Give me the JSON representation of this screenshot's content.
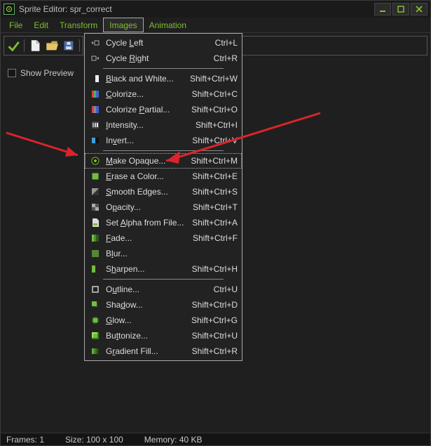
{
  "title": "Sprite Editor: spr_correct",
  "menubar": [
    "File",
    "Edit",
    "Transform",
    "Images",
    "Animation"
  ],
  "menubar_active_index": 3,
  "show_preview_label": "Show Preview",
  "status": {
    "frames_label": "Frames:",
    "frames_value": "1",
    "size_label": "Size:",
    "size_value": "100 x 100",
    "memory_label": "Memory:",
    "memory_value": "40 KB"
  },
  "dropdown": {
    "highlight_index": 7,
    "items": [
      {
        "label": "Cycle Left",
        "u": 6,
        "short": "Ctrl+L",
        "icon": "cycle-left-icon"
      },
      {
        "label": "Cycle Right",
        "u": 6,
        "short": "Ctrl+R",
        "icon": "cycle-right-icon"
      },
      {
        "sep": true
      },
      {
        "label": "Black and White...",
        "u": 0,
        "short": "Shift+Ctrl+W",
        "icon": "bw-icon"
      },
      {
        "label": "Colorize...",
        "u": 0,
        "short": "Shift+Ctrl+C",
        "icon": "colorize-icon"
      },
      {
        "label": "Colorize Partial...",
        "u": 9,
        "short": "Shift+Ctrl+O",
        "icon": "colorize-partial-icon"
      },
      {
        "label": "Intensity...",
        "u": 0,
        "short": "Shift+Ctrl+I",
        "icon": "intensity-icon"
      },
      {
        "label": "Invert...",
        "u": 2,
        "short": "Shift+Ctrl+V",
        "icon": "invert-icon"
      },
      {
        "sep": true
      },
      {
        "label": "Make Opaque...",
        "u": 0,
        "short": "Shift+Ctrl+M",
        "icon": "opaque-icon"
      },
      {
        "label": "Erase a Color...",
        "u": 0,
        "short": "Shift+Ctrl+E",
        "icon": "erase-color-icon"
      },
      {
        "label": "Smooth Edges...",
        "u": 0,
        "short": "Shift+Ctrl+S",
        "icon": "smooth-icon"
      },
      {
        "label": "Opacity...",
        "u": 1,
        "short": "Shift+Ctrl+T",
        "icon": "opacity-icon"
      },
      {
        "label": "Set Alpha from File...",
        "u": 4,
        "short": "Shift+Ctrl+A",
        "icon": "alpha-file-icon"
      },
      {
        "label": "Fade...",
        "u": 0,
        "short": "Shift+Ctrl+F",
        "icon": "fade-icon"
      },
      {
        "label": "Blur...",
        "u": 1,
        "short": "",
        "icon": "blur-icon"
      },
      {
        "label": "Sharpen...",
        "u": 1,
        "short": "Shift+Ctrl+H",
        "icon": "sharpen-icon"
      },
      {
        "sep": true
      },
      {
        "label": "Outline...",
        "u": 1,
        "short": "Ctrl+U",
        "icon": "outline-icon"
      },
      {
        "label": "Shadow...",
        "u": 3,
        "short": "Shift+Ctrl+D",
        "icon": "shadow-icon"
      },
      {
        "label": "Glow...",
        "u": 0,
        "short": "Shift+Ctrl+G",
        "icon": "glow-icon"
      },
      {
        "label": "Buttonize...",
        "u": 2,
        "short": "Shift+Ctrl+U",
        "icon": "buttonize-icon"
      },
      {
        "label": "Gradient Fill...",
        "u": 1,
        "short": "Shift+Ctrl+R",
        "icon": "gradient-icon"
      }
    ]
  },
  "colors": {
    "green": "#7fbf2f",
    "arrow_red": "#d9252a"
  }
}
